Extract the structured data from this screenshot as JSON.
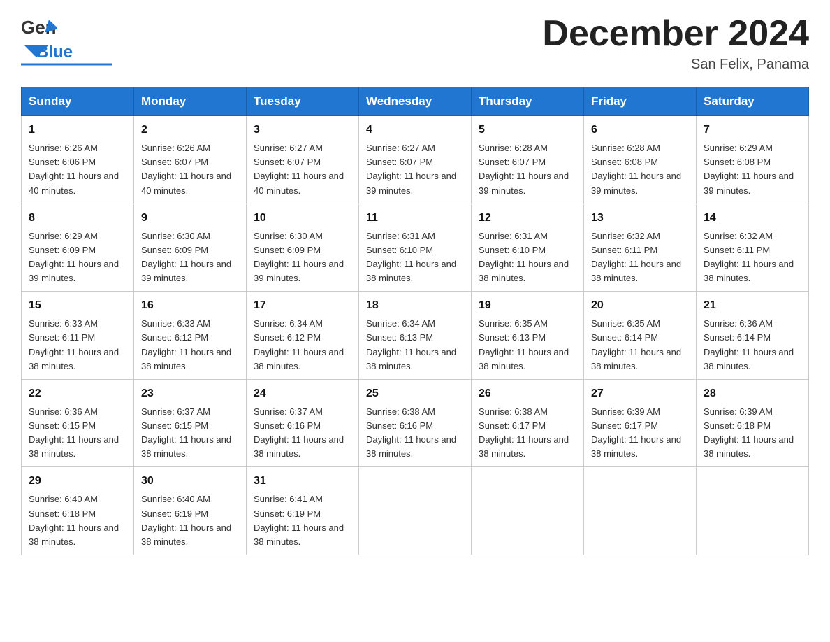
{
  "header": {
    "logo_general": "General",
    "logo_blue": "Blue",
    "month_title": "December 2024",
    "location": "San Felix, Panama"
  },
  "weekdays": [
    "Sunday",
    "Monday",
    "Tuesday",
    "Wednesday",
    "Thursday",
    "Friday",
    "Saturday"
  ],
  "weeks": [
    [
      {
        "day": "1",
        "sunrise": "6:26 AM",
        "sunset": "6:06 PM",
        "daylight": "11 hours and 40 minutes."
      },
      {
        "day": "2",
        "sunrise": "6:26 AM",
        "sunset": "6:07 PM",
        "daylight": "11 hours and 40 minutes."
      },
      {
        "day": "3",
        "sunrise": "6:27 AM",
        "sunset": "6:07 PM",
        "daylight": "11 hours and 40 minutes."
      },
      {
        "day": "4",
        "sunrise": "6:27 AM",
        "sunset": "6:07 PM",
        "daylight": "11 hours and 39 minutes."
      },
      {
        "day": "5",
        "sunrise": "6:28 AM",
        "sunset": "6:07 PM",
        "daylight": "11 hours and 39 minutes."
      },
      {
        "day": "6",
        "sunrise": "6:28 AM",
        "sunset": "6:08 PM",
        "daylight": "11 hours and 39 minutes."
      },
      {
        "day": "7",
        "sunrise": "6:29 AM",
        "sunset": "6:08 PM",
        "daylight": "11 hours and 39 minutes."
      }
    ],
    [
      {
        "day": "8",
        "sunrise": "6:29 AM",
        "sunset": "6:09 PM",
        "daylight": "11 hours and 39 minutes."
      },
      {
        "day": "9",
        "sunrise": "6:30 AM",
        "sunset": "6:09 PM",
        "daylight": "11 hours and 39 minutes."
      },
      {
        "day": "10",
        "sunrise": "6:30 AM",
        "sunset": "6:09 PM",
        "daylight": "11 hours and 39 minutes."
      },
      {
        "day": "11",
        "sunrise": "6:31 AM",
        "sunset": "6:10 PM",
        "daylight": "11 hours and 38 minutes."
      },
      {
        "day": "12",
        "sunrise": "6:31 AM",
        "sunset": "6:10 PM",
        "daylight": "11 hours and 38 minutes."
      },
      {
        "day": "13",
        "sunrise": "6:32 AM",
        "sunset": "6:11 PM",
        "daylight": "11 hours and 38 minutes."
      },
      {
        "day": "14",
        "sunrise": "6:32 AM",
        "sunset": "6:11 PM",
        "daylight": "11 hours and 38 minutes."
      }
    ],
    [
      {
        "day": "15",
        "sunrise": "6:33 AM",
        "sunset": "6:11 PM",
        "daylight": "11 hours and 38 minutes."
      },
      {
        "day": "16",
        "sunrise": "6:33 AM",
        "sunset": "6:12 PM",
        "daylight": "11 hours and 38 minutes."
      },
      {
        "day": "17",
        "sunrise": "6:34 AM",
        "sunset": "6:12 PM",
        "daylight": "11 hours and 38 minutes."
      },
      {
        "day": "18",
        "sunrise": "6:34 AM",
        "sunset": "6:13 PM",
        "daylight": "11 hours and 38 minutes."
      },
      {
        "day": "19",
        "sunrise": "6:35 AM",
        "sunset": "6:13 PM",
        "daylight": "11 hours and 38 minutes."
      },
      {
        "day": "20",
        "sunrise": "6:35 AM",
        "sunset": "6:14 PM",
        "daylight": "11 hours and 38 minutes."
      },
      {
        "day": "21",
        "sunrise": "6:36 AM",
        "sunset": "6:14 PM",
        "daylight": "11 hours and 38 minutes."
      }
    ],
    [
      {
        "day": "22",
        "sunrise": "6:36 AM",
        "sunset": "6:15 PM",
        "daylight": "11 hours and 38 minutes."
      },
      {
        "day": "23",
        "sunrise": "6:37 AM",
        "sunset": "6:15 PM",
        "daylight": "11 hours and 38 minutes."
      },
      {
        "day": "24",
        "sunrise": "6:37 AM",
        "sunset": "6:16 PM",
        "daylight": "11 hours and 38 minutes."
      },
      {
        "day": "25",
        "sunrise": "6:38 AM",
        "sunset": "6:16 PM",
        "daylight": "11 hours and 38 minutes."
      },
      {
        "day": "26",
        "sunrise": "6:38 AM",
        "sunset": "6:17 PM",
        "daylight": "11 hours and 38 minutes."
      },
      {
        "day": "27",
        "sunrise": "6:39 AM",
        "sunset": "6:17 PM",
        "daylight": "11 hours and 38 minutes."
      },
      {
        "day": "28",
        "sunrise": "6:39 AM",
        "sunset": "6:18 PM",
        "daylight": "11 hours and 38 minutes."
      }
    ],
    [
      {
        "day": "29",
        "sunrise": "6:40 AM",
        "sunset": "6:18 PM",
        "daylight": "11 hours and 38 minutes."
      },
      {
        "day": "30",
        "sunrise": "6:40 AM",
        "sunset": "6:19 PM",
        "daylight": "11 hours and 38 minutes."
      },
      {
        "day": "31",
        "sunrise": "6:41 AM",
        "sunset": "6:19 PM",
        "daylight": "11 hours and 38 minutes."
      },
      null,
      null,
      null,
      null
    ]
  ],
  "labels": {
    "sunrise_prefix": "Sunrise: ",
    "sunset_prefix": "Sunset: ",
    "daylight_prefix": "Daylight: "
  }
}
